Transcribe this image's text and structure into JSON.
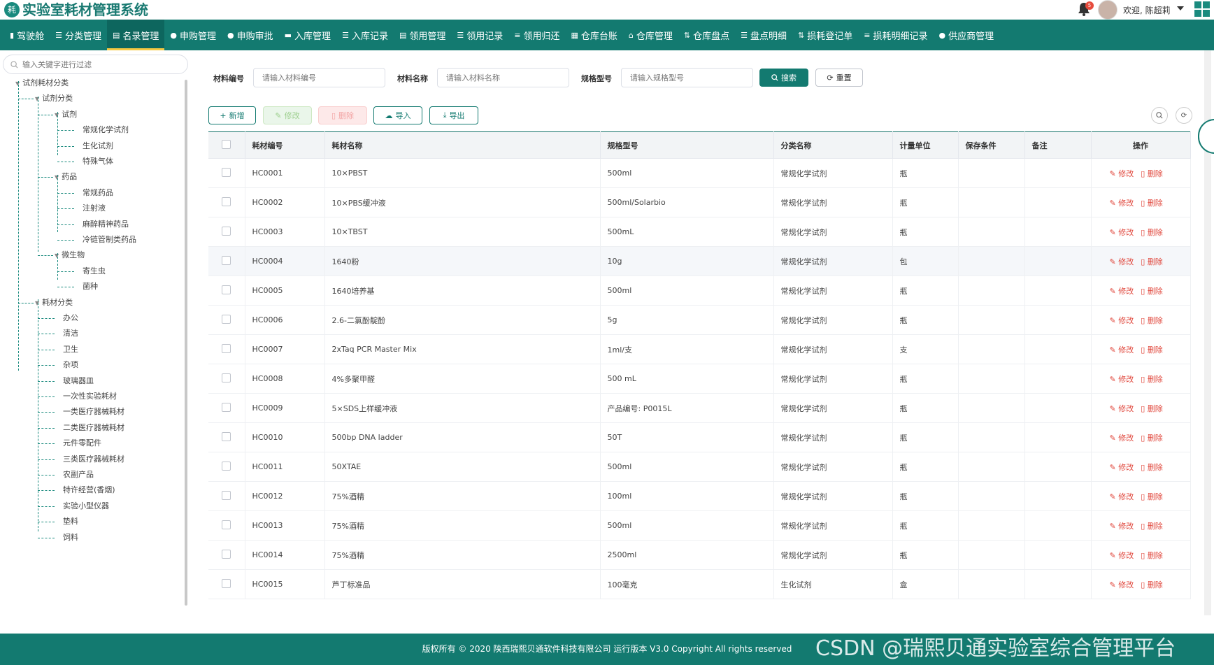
{
  "header": {
    "logo_char": "耗",
    "title": "实验室耗材管理系统",
    "bell_badge": "5",
    "welcome": "欢迎, 陈超莉"
  },
  "nav": [
    {
      "icon": "chart-icon",
      "glyph": "▮",
      "label": "驾驶舱"
    },
    {
      "icon": "category-icon",
      "glyph": "☰",
      "label": "分类管理"
    },
    {
      "icon": "book-icon",
      "glyph": "▤",
      "label": "名录管理",
      "active": true
    },
    {
      "icon": "user-icon",
      "glyph": "●",
      "label": "申购管理"
    },
    {
      "icon": "approve-icon",
      "glyph": "●",
      "label": "申购审批"
    },
    {
      "icon": "truck-icon",
      "glyph": "▬",
      "label": "入库管理"
    },
    {
      "icon": "list-icon",
      "glyph": "☰",
      "label": "入库记录"
    },
    {
      "icon": "doc-icon",
      "glyph": "▤",
      "label": "领用管理"
    },
    {
      "icon": "list-icon",
      "glyph": "☰",
      "label": "领用记录"
    },
    {
      "icon": "filter-icon",
      "glyph": "≡",
      "label": "领用归还"
    },
    {
      "icon": "qrcode-icon",
      "glyph": "▦",
      "label": "仓库台账"
    },
    {
      "icon": "home-icon",
      "glyph": "⌂",
      "label": "仓库管理"
    },
    {
      "icon": "sort-icon",
      "glyph": "⇅",
      "label": "仓库盘点"
    },
    {
      "icon": "list-icon",
      "glyph": "☰",
      "label": "盘点明细"
    },
    {
      "icon": "sort-icon",
      "glyph": "⇅",
      "label": "损耗登记单"
    },
    {
      "icon": "filter-icon",
      "glyph": "≡",
      "label": "损耗明细记录"
    },
    {
      "icon": "users-icon",
      "glyph": "●",
      "label": "供应商管理"
    }
  ],
  "sidebar": {
    "search_placeholder": "输入关键字进行过滤",
    "tree": [
      {
        "label": "试剂耗材分类",
        "level": 0,
        "expanded": true
      },
      {
        "label": "试剂分类",
        "level": 1,
        "expanded": true
      },
      {
        "label": "试剂",
        "level": 2,
        "expanded": true
      },
      {
        "label": "常规化学试剂",
        "level": 3
      },
      {
        "label": "生化试剂",
        "level": 3
      },
      {
        "label": "特殊气体",
        "level": 3
      },
      {
        "label": "药品",
        "level": 2,
        "expanded": true
      },
      {
        "label": "常规药品",
        "level": 3
      },
      {
        "label": "注射液",
        "level": 3
      },
      {
        "label": "麻醉精神药品",
        "level": 3
      },
      {
        "label": "冷链管制类药品",
        "level": 3
      },
      {
        "label": "微生物",
        "level": 2,
        "expanded": true
      },
      {
        "label": "寄生虫",
        "level": 3
      },
      {
        "label": "菌种",
        "level": 3
      },
      {
        "label": "耗材分类",
        "level": 1,
        "expanded": true
      },
      {
        "label": "办公",
        "level": 2
      },
      {
        "label": "清洁",
        "level": 2
      },
      {
        "label": "卫生",
        "level": 2
      },
      {
        "label": "杂项",
        "level": 2
      },
      {
        "label": "玻璃器皿",
        "level": 2
      },
      {
        "label": "一次性实验耗材",
        "level": 2
      },
      {
        "label": "一类医疗器械耗材",
        "level": 2
      },
      {
        "label": "二类医疗器械耗材",
        "level": 2
      },
      {
        "label": "元件零配件",
        "level": 2
      },
      {
        "label": "三类医疗器械耗材",
        "level": 2
      },
      {
        "label": "农副产品",
        "level": 2
      },
      {
        "label": "特许经营(香烟)",
        "level": 2
      },
      {
        "label": "实验小型仪器",
        "level": 2
      },
      {
        "label": "垫料",
        "level": 2
      },
      {
        "label": "饲料",
        "level": 2
      }
    ]
  },
  "filters": {
    "code_label": "材料编号",
    "code_placeholder": "请输入材料编号",
    "name_label": "材料名称",
    "name_placeholder": "请输入材料名称",
    "spec_label": "规格型号",
    "spec_placeholder": "请输入规格型号",
    "search_btn": "搜索",
    "reset_btn": "重置"
  },
  "toolbar": {
    "add": "新增",
    "edit": "修改",
    "delete": "删除",
    "import": "导入",
    "export": "导出"
  },
  "table": {
    "columns": [
      "耗材编号",
      "耗材名称",
      "规格型号",
      "分类名称",
      "计量单位",
      "保存条件",
      "备注",
      "操作"
    ],
    "op_edit": "修改",
    "op_delete": "删除",
    "rows": [
      {
        "code": "HC0001",
        "name": "10×PBST",
        "spec": "500ml",
        "cat": "常规化学试剂",
        "unit": "瓶",
        "cond": "",
        "note": ""
      },
      {
        "code": "HC0002",
        "name": "10×PBS缓冲液",
        "spec": "500ml/Solarbio",
        "cat": "常规化学试剂",
        "unit": "瓶",
        "cond": "",
        "note": ""
      },
      {
        "code": "HC0003",
        "name": "10×TBST",
        "spec": "500mL",
        "cat": "常规化学试剂",
        "unit": "瓶",
        "cond": "",
        "note": ""
      },
      {
        "code": "HC0004",
        "name": "1640粉",
        "spec": "10g",
        "cat": "常规化学试剂",
        "unit": "包",
        "cond": "",
        "note": ""
      },
      {
        "code": "HC0005",
        "name": "1640培养基",
        "spec": "500ml",
        "cat": "常规化学试剂",
        "unit": "瓶",
        "cond": "",
        "note": ""
      },
      {
        "code": "HC0006",
        "name": "2.6-二氯酚靛酚",
        "spec": "5g",
        "cat": "常规化学试剂",
        "unit": "瓶",
        "cond": "",
        "note": ""
      },
      {
        "code": "HC0007",
        "name": "2xTaq PCR Master Mix",
        "spec": "1ml/支",
        "cat": "常规化学试剂",
        "unit": "支",
        "cond": "",
        "note": ""
      },
      {
        "code": "HC0008",
        "name": "4%多聚甲醛",
        "spec": "500 mL",
        "cat": "常规化学试剂",
        "unit": "瓶",
        "cond": "",
        "note": ""
      },
      {
        "code": "HC0009",
        "name": "5×SDS上样缓冲液",
        "spec": "产品编号: P0015L",
        "cat": "常规化学试剂",
        "unit": "瓶",
        "cond": "",
        "note": ""
      },
      {
        "code": "HC0010",
        "name": "500bp DNA ladder",
        "spec": "50T",
        "cat": "常规化学试剂",
        "unit": "瓶",
        "cond": "",
        "note": ""
      },
      {
        "code": "HC0011",
        "name": "50XTAE",
        "spec": "500ml",
        "cat": "常规化学试剂",
        "unit": "瓶",
        "cond": "",
        "note": ""
      },
      {
        "code": "HC0012",
        "name": "75%酒精",
        "spec": "100ml",
        "cat": "常规化学试剂",
        "unit": "瓶",
        "cond": "",
        "note": ""
      },
      {
        "code": "HC0013",
        "name": "75%酒精",
        "spec": "500ml",
        "cat": "常规化学试剂",
        "unit": "瓶",
        "cond": "",
        "note": ""
      },
      {
        "code": "HC0014",
        "name": "75%酒精",
        "spec": "2500ml",
        "cat": "常规化学试剂",
        "unit": "瓶",
        "cond": "",
        "note": ""
      },
      {
        "code": "HC0015",
        "name": "芦丁标准品",
        "spec": "100毫克",
        "cat": "生化试剂",
        "unit": "盒",
        "cond": "",
        "note": ""
      }
    ]
  },
  "footer": {
    "text": "版权所有 © 2020 陕西瑞熙贝通软件科技有限公司 运行版本 V3.0 Copyright All rights reserved",
    "watermark": "CSDN @瑞熙贝通实验室综合管理平台"
  },
  "colors": {
    "brand": "#137a70",
    "danger": "#e0453a",
    "active_underline": "#f5c842"
  }
}
